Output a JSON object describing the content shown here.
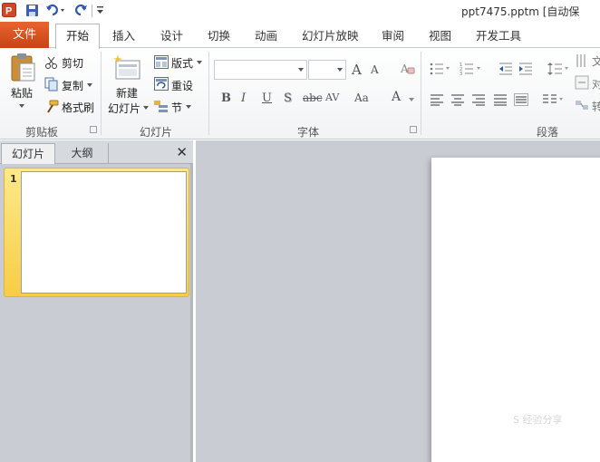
{
  "window": {
    "title": "ppt7475.pptm [自动保"
  },
  "qat": {
    "app_icon": "powerpoint-icon",
    "save_icon": "save-icon",
    "undo_icon": "undo-icon",
    "redo_icon": "redo-icon",
    "customize_icon": "customize-qat-icon"
  },
  "tabs": {
    "file": "文件",
    "items": [
      "开始",
      "插入",
      "设计",
      "切换",
      "动画",
      "幻灯片放映",
      "审阅",
      "视图",
      "开发工具"
    ]
  },
  "ribbon": {
    "clipboard": {
      "group_label": "剪贴板",
      "paste": "粘贴",
      "cut": "剪切",
      "copy": "复制",
      "format_painter": "格式刷"
    },
    "slides": {
      "group_label": "幻灯片",
      "new_slide_line1": "新建",
      "new_slide_line2": "幻灯片",
      "layout": "版式",
      "reset": "重设",
      "section": "节"
    },
    "font": {
      "group_label": "字体",
      "font_name": "",
      "font_size": "",
      "grow": "A",
      "shrink": "A",
      "bold": "B",
      "italic": "I",
      "underline": "U",
      "shadow": "S",
      "strike": "abc",
      "spacing": "AV",
      "case": "Aa",
      "color": "A"
    },
    "paragraph": {
      "group_label": "段落",
      "text_dir": "文",
      "align_text": "对",
      "convert": "转"
    }
  },
  "left_pane": {
    "tab_slides": "幻灯片",
    "tab_outline": "大纲",
    "close": "✕",
    "slides": [
      {
        "number": "1"
      }
    ]
  },
  "watermark": "S 经验分享"
}
